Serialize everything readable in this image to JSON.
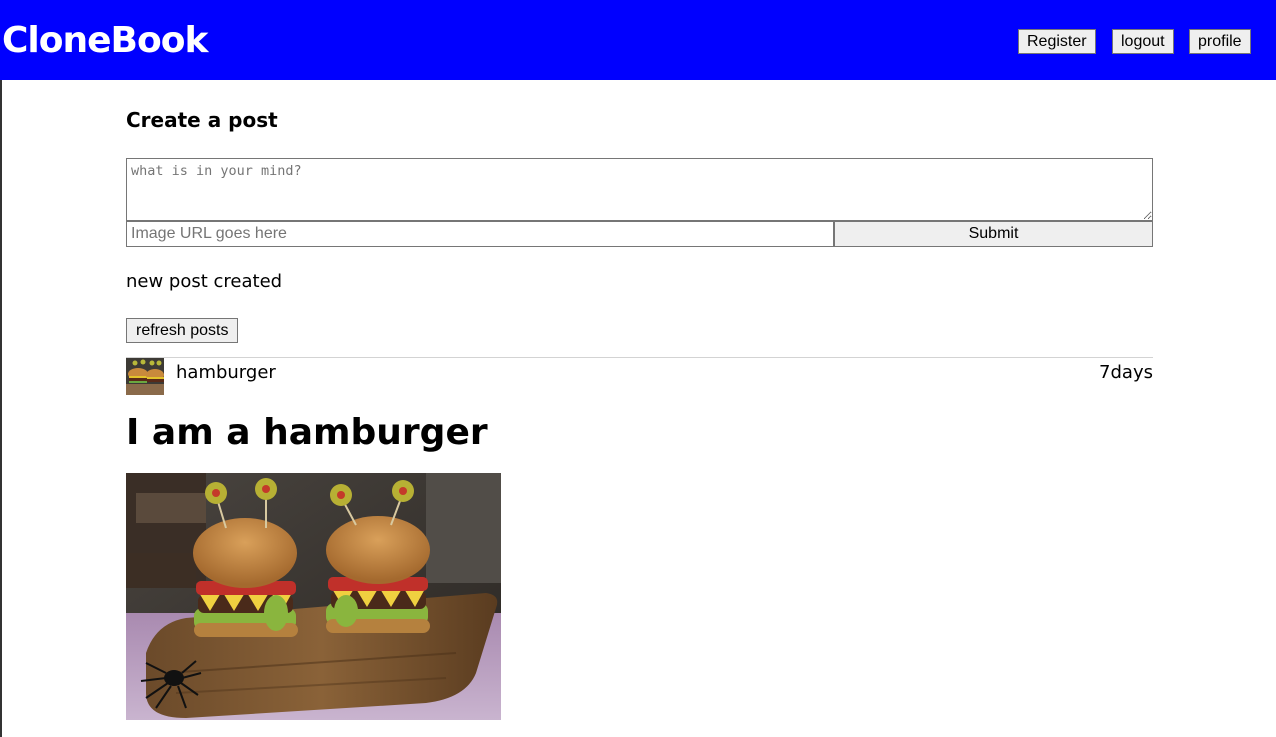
{
  "header": {
    "brand": "CloneBook",
    "background_color": "#0000ff",
    "nav": {
      "register_label": "Register",
      "logout_label": "logout",
      "profile_label": "profile"
    }
  },
  "create_post": {
    "title": "Create a post",
    "textarea_placeholder": "what is in your mind?",
    "image_url_placeholder": "Image URL goes here",
    "submit_label": "Submit"
  },
  "status_message": "new post created",
  "refresh_label": "refresh posts",
  "posts": [
    {
      "username": "hamburger",
      "timestamp": "7days",
      "title": "I am a hamburger",
      "avatar_icon": "hamburger-avatar",
      "image_description_icon": "hamburger-photo"
    }
  ]
}
